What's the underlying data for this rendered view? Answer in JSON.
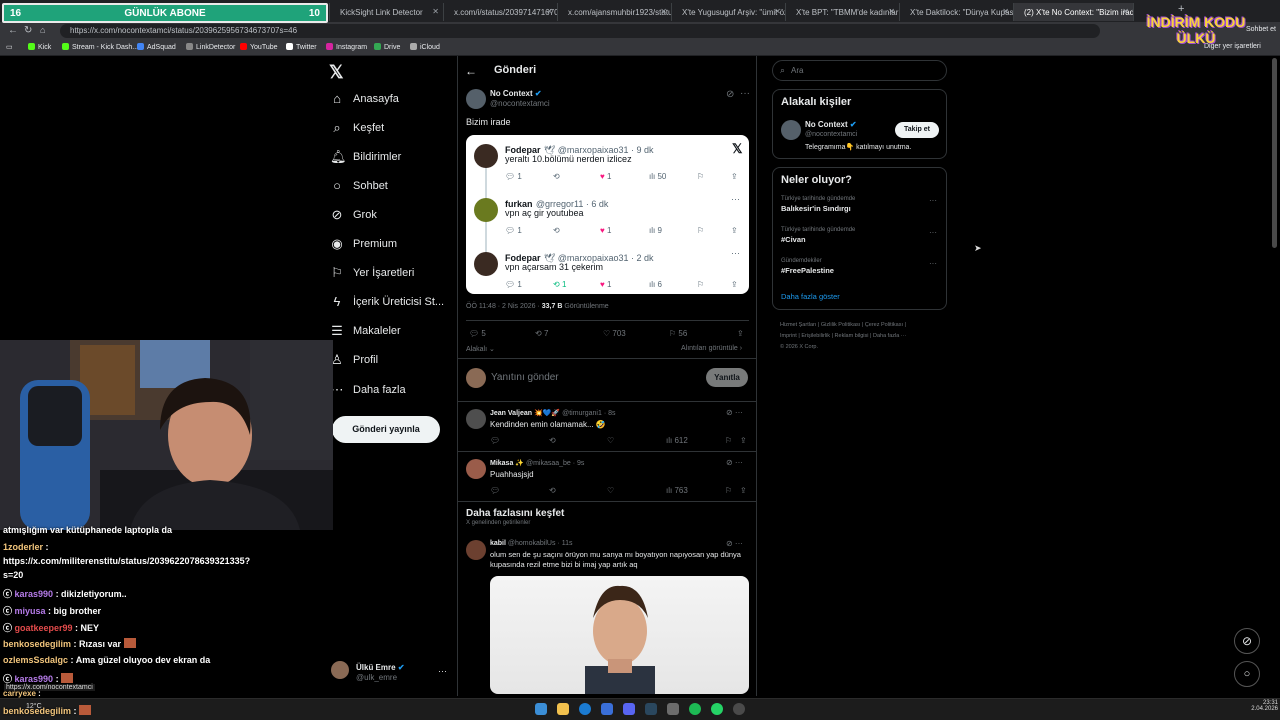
{
  "overlay": {
    "sub_left": "16",
    "sub_title": "GÜNLÜK ABONE",
    "sub_right": "10",
    "promo_top": "İNDİRİM KODU",
    "promo_bottom": "ÜLKÜ"
  },
  "browser": {
    "tabs": [
      "rd",
      "KickSight Link Detector",
      "x.com/i/status/2039714716709...",
      "x.com/ajansmuhbir1923/status/...",
      "X'te Yugusuguf Arşiv: \"ümit özas...",
      "X'te BPT: \"TBMM'de kadınların d...",
      "X'te Daktilock: \"Dünya Kupası ön...",
      "(2) X'te No Context: \"Bizim irade..."
    ],
    "url": "https://x.com/nocontextamci/status/2039625956734673707s=46",
    "bookmarks": [
      "Kick",
      "Stream - Kick Dash...",
      "AdSquad",
      "LinkDetector",
      "YouTube",
      "Twitter",
      "Instagram",
      "Drive",
      "iCloud"
    ],
    "other_bookmarks": "Diğer yer işaretleri",
    "chat_btn": "Sohbet et"
  },
  "nav": {
    "items": [
      "Anasayfa",
      "Keşfet",
      "Bildirimler",
      "Sohbet",
      "Grok",
      "Premium",
      "Yer İşaretleri",
      "İçerik Üreticisi St...",
      "Makaleler",
      "Profil",
      "Daha fazla"
    ],
    "post_button": "Gönderi yayınla",
    "account_name": "Ülkü Emre",
    "account_handle": "@ulk_emre",
    "more": "···"
  },
  "main": {
    "header": "Gönderi",
    "post": {
      "name": "No Context",
      "handle": "@nocontextamci",
      "text": "Bizim irade",
      "meta_time": "ÖÖ 11:48 · 2 Nis 2026 · ",
      "views": "33,7 B",
      "views_label": " Görüntülenme",
      "replies": "5",
      "reposts": "7",
      "likes": "703",
      "bookmarks": "56",
      "relevant": "Alakalı",
      "quotes": "Alıntıları görüntüle"
    },
    "embed": [
      {
        "name": "Fodepar",
        "handle": "@marxopaixao31 · 9 dk",
        "text": "yeraltı 10.bölümü nerden izlicez",
        "reply": "1",
        "like": "1",
        "views": "50"
      },
      {
        "name": "furkan",
        "handle": "@grregor11 · 6 dk",
        "text": "vpn aç gir youtubea",
        "reply": "1",
        "like": "1",
        "views": "9"
      },
      {
        "name": "Fodepar",
        "handle": "@marxopaixao31 · 2 dk",
        "text": "vpn açarsam 31 çekerim",
        "reply": "1",
        "retweet": "1",
        "like": "1",
        "views": "6"
      }
    ],
    "reply_placeholder": "Yanıtını gönder",
    "reply_button": "Yanıtla",
    "replies": [
      {
        "name": "Jean Valjean",
        "handle": "@timurgani1 · 8s",
        "text": "Kendinden emin olamamak... 🤣",
        "views": "612"
      },
      {
        "name": "Mikasa ✨",
        "handle": "@mikasaa_be · 9s",
        "text": "Puahhasjsjd",
        "views": "763"
      }
    ],
    "discover_title": "Daha fazlasını keşfet",
    "discover_sub": "X genelinden getirilenler",
    "discover_post": {
      "name": "kabil",
      "handle": "@homokabilUs · 11s",
      "text": "olum sen de şu saçını örüyon mu sanya mı boyatıyon napıyosan yap dünya kupasında rezil etme bizi bi imaj yap artık aq"
    }
  },
  "right": {
    "search_placeholder": "Ara",
    "related_title": "Alakalı kişiler",
    "related": {
      "name": "No Context",
      "handle": "@nocontextamci",
      "bio": "Telegramıma👇 katılmayı unutma.",
      "follow": "Takip et"
    },
    "trends_title": "Neler oluyor?",
    "trends": [
      {
        "context": "Türkiye tarihinde gündemde",
        "tag": "Balıkesir'in Sındırgı"
      },
      {
        "context": "Türkiye tarihinde gündemde",
        "tag": "#Civan"
      },
      {
        "context": "Gündemdekiler",
        "tag": "#FreePalestine"
      }
    ],
    "show_more": "Daha fazla göster",
    "footer": [
      "Hizmet Şartları",
      "Gizlilik Politikası",
      "Çerez Politikası",
      "Imprint",
      "Erişilebilirlik",
      "Reklam bilgisi",
      "Daha fazla ···",
      "© 2026 X Corp."
    ]
  },
  "chat": [
    {
      "user": "",
      "text": "atmışlığım var kütüphanede laptopla da"
    },
    {
      "user": "1zoderler",
      "text": " :"
    },
    {
      "user": "",
      "text": "https://x.com/militerenstitu/status/2039622078639321335?"
    },
    {
      "user": "",
      "text": "s=20"
    },
    {
      "user": "karas990",
      "text": " : dikizletiyorum.."
    },
    {
      "user": "miyusa",
      "text": " : big brother"
    },
    {
      "user": "goatkeeper99",
      "text": " : NEY"
    },
    {
      "user": "benkosedegilim",
      "text": " : Rızası var"
    },
    {
      "user": "ozlemsSsdalgc",
      "text": " : Ama güzel oluyoo dev ekran da"
    },
    {
      "user": "karas990",
      "text": " :"
    },
    {
      "user": "carryexe",
      "text": " :"
    },
    {
      "user": "benkosedegilim",
      "text": " :"
    }
  ],
  "status_url": "https://x.com/nocontextamci",
  "taskbar": {
    "weather": "12°C",
    "time": "23:31",
    "date": "2.04.2026"
  }
}
